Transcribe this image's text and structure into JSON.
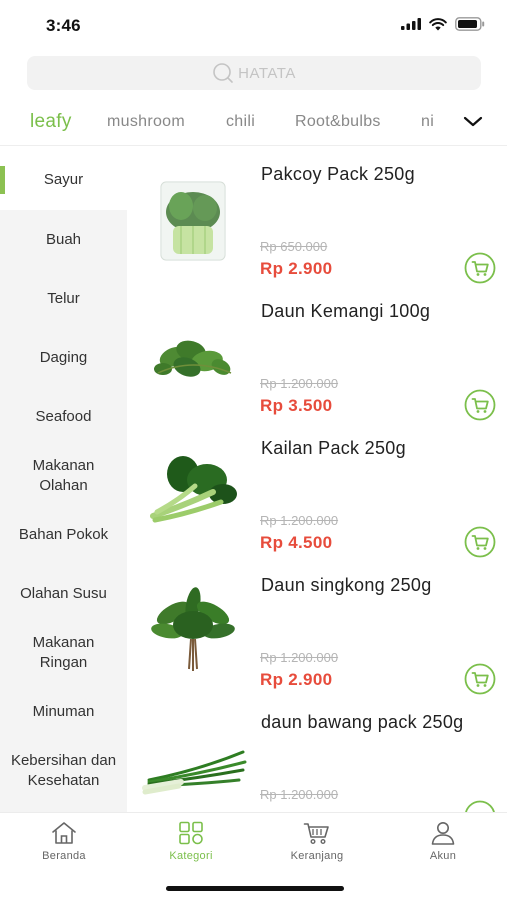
{
  "status": {
    "time": "3:46"
  },
  "search": {
    "placeholder": "HATATA"
  },
  "tabs": [
    {
      "label": "leafy",
      "active": true
    },
    {
      "label": "mushroom"
    },
    {
      "label": "chili"
    },
    {
      "label": "Root&bulbs"
    },
    {
      "label": "ni"
    }
  ],
  "sidebar": [
    {
      "label": "Sayur",
      "active": true
    },
    {
      "label": "Buah"
    },
    {
      "label": "Telur"
    },
    {
      "label": "Daging"
    },
    {
      "label": "Seafood"
    },
    {
      "label": "Makanan Olahan"
    },
    {
      "label": "Bahan Pokok"
    },
    {
      "label": "Olahan Susu"
    },
    {
      "label": "Makanan Ringan"
    },
    {
      "label": "Minuman"
    },
    {
      "label": "Kebersihan dan Kesehatan"
    }
  ],
  "products": [
    {
      "name": "Pakcoy Pack 250g",
      "old_price": "Rp 650.000",
      "price": "Rp 2.900",
      "image": "pakcoy-pack"
    },
    {
      "name": "Daun Kemangi 100g",
      "old_price": "Rp 1.200.000",
      "price": "Rp 3.500",
      "image": "basil-leaves"
    },
    {
      "name": "Kailan Pack 250g",
      "old_price": "Rp 1.200.000",
      "price": "Rp 4.500",
      "image": "kailan"
    },
    {
      "name": "Daun singkong 250g",
      "old_price": "Rp 1.200.000",
      "price": "Rp 2.900",
      "image": "cassava-leaves"
    },
    {
      "name": "daun bawang pack 250g",
      "old_price": "Rp 1.200.000",
      "price": "",
      "image": "spring-onion"
    }
  ],
  "bottom_nav": [
    {
      "label": "Beranda",
      "icon": "home-icon"
    },
    {
      "label": "Kategori",
      "icon": "category-icon",
      "active": true
    },
    {
      "label": "Keranjang",
      "icon": "cart-icon"
    },
    {
      "label": "Akun",
      "icon": "user-icon"
    }
  ],
  "colors": {
    "accent": "#7bbf4b",
    "price": "#e74c3c"
  }
}
